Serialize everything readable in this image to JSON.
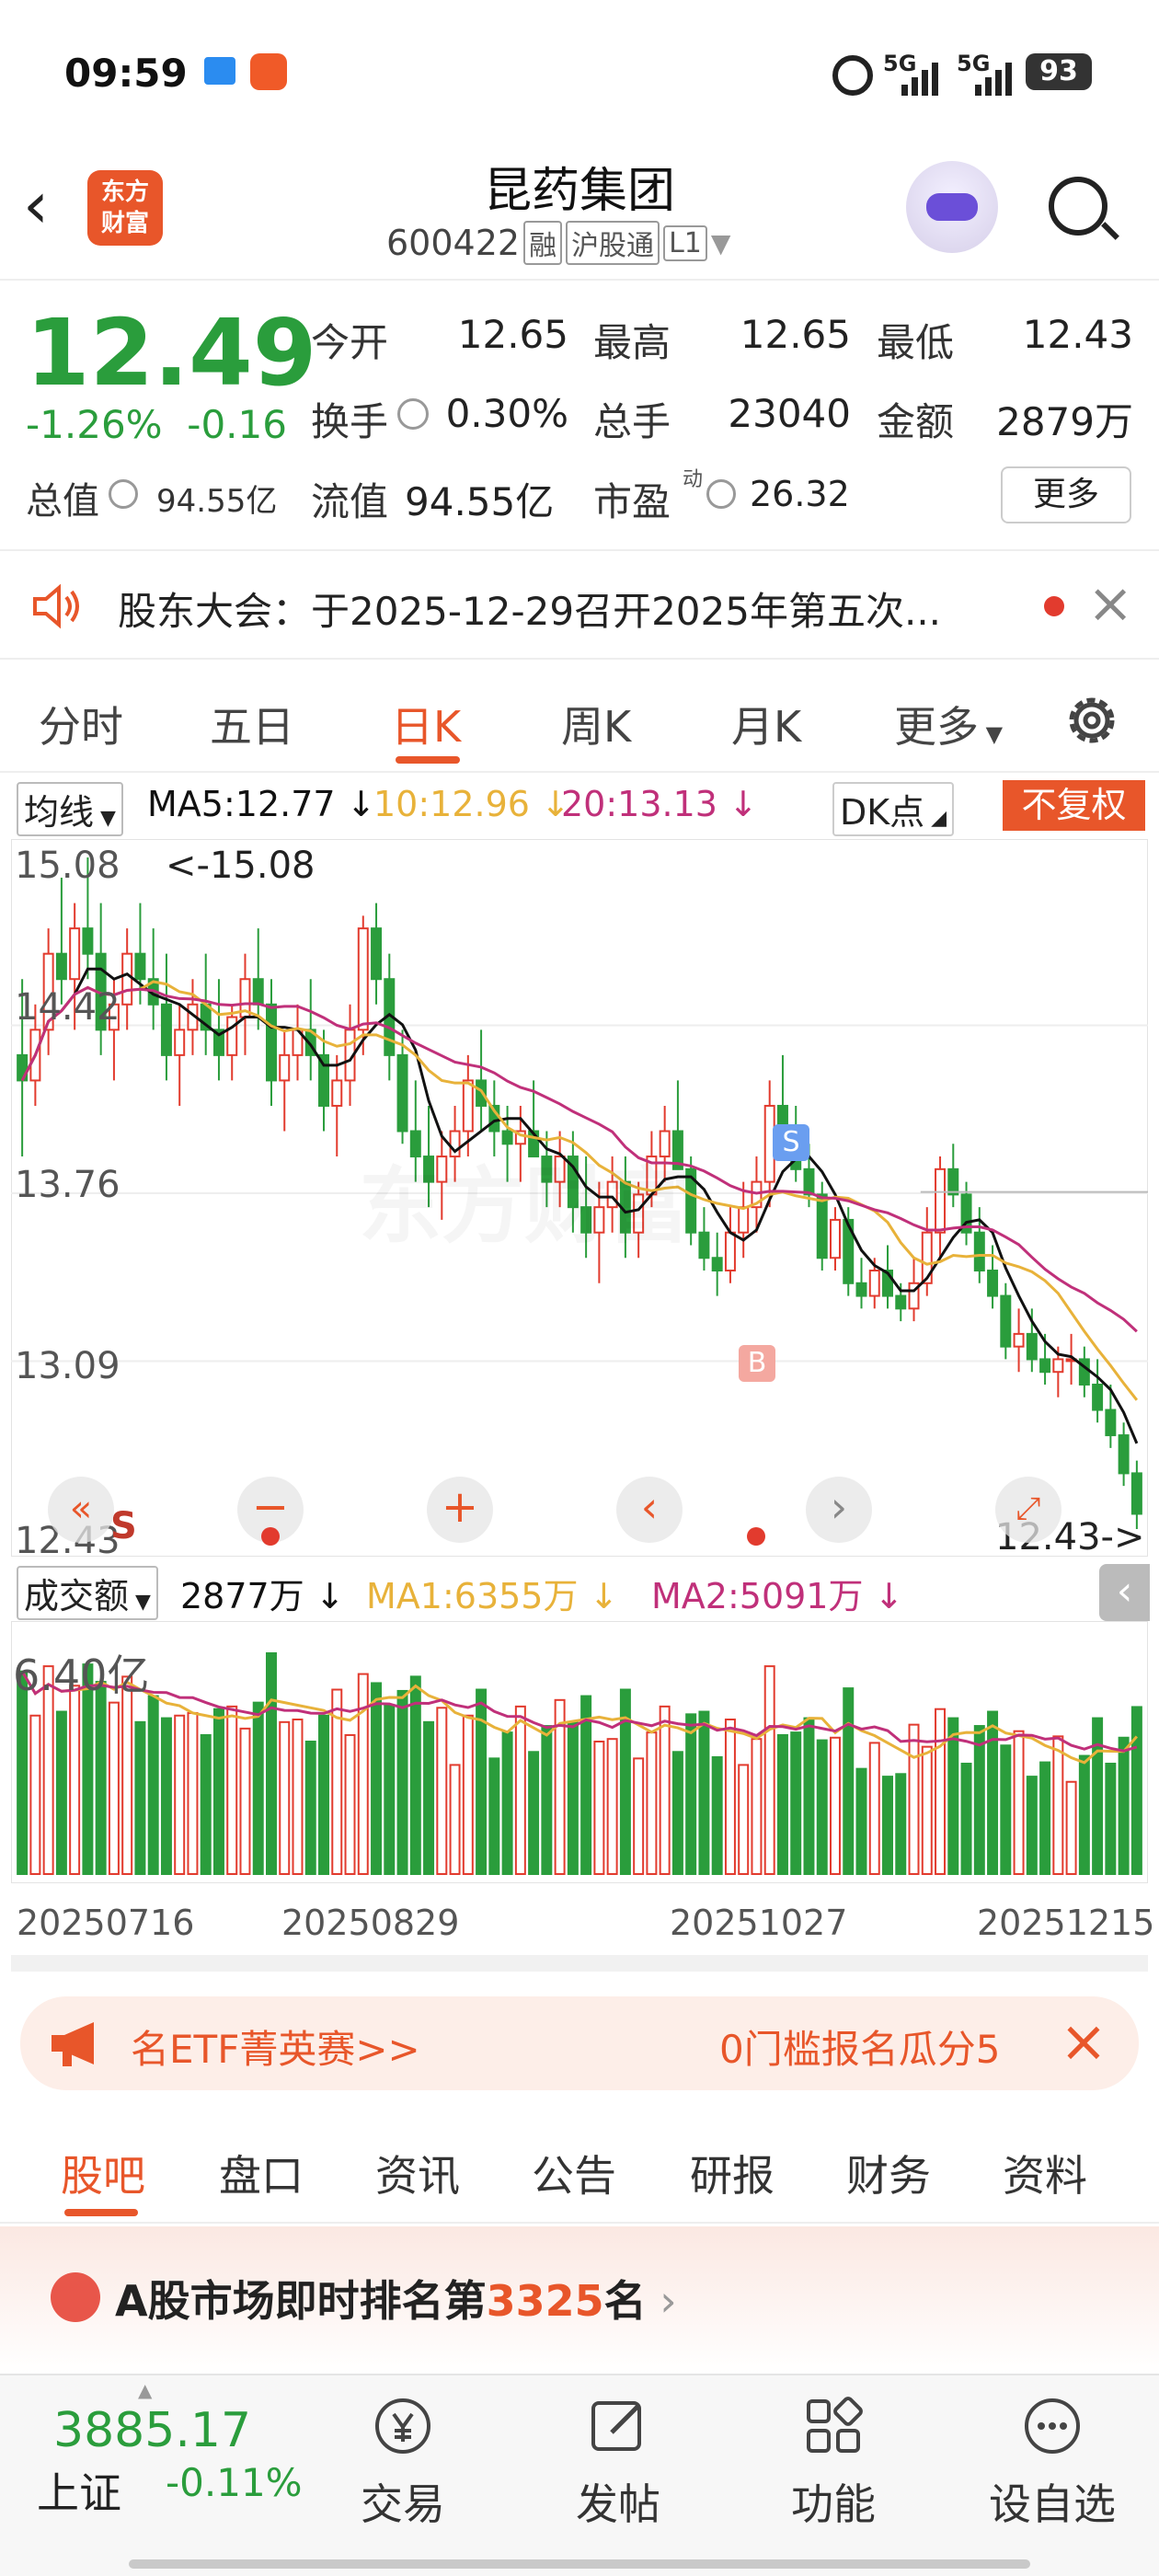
{
  "status_bar": {
    "time": "09:59",
    "net1": "5G",
    "net2": "5G",
    "battery": "93"
  },
  "header": {
    "back_icon": "chevron-left-icon",
    "logo_line1": "东方",
    "logo_line2": "财富",
    "title": "昆药集团",
    "code": "600422",
    "tags": [
      "融",
      "沪股通",
      "L1"
    ]
  },
  "quote": {
    "price": "12.49",
    "change_pct": "-1.26%",
    "change_amt": "-0.16",
    "rows": [
      [
        {
          "label": "今开",
          "value": "12.65"
        },
        {
          "label": "最高",
          "value": "12.65"
        },
        {
          "label": "最低",
          "value": "12.43"
        }
      ],
      [
        {
          "label": "换手",
          "value": "0.30%"
        },
        {
          "label": "总手",
          "value": "23040"
        },
        {
          "label": "金额",
          "value": "2879万"
        }
      ]
    ],
    "total_value_label": "总值",
    "total_value": "94.55亿",
    "float_value_label": "流值",
    "float_value": "94.55亿",
    "pe_label": "市盈",
    "pe_sup": "动",
    "pe_value": "26.32",
    "more_label": "更多"
  },
  "notice": {
    "text": "股东大会：于2025-12-29召开2025年第五次..."
  },
  "period_tabs": [
    "分时",
    "五日",
    "日K",
    "周K",
    "月K",
    "更多"
  ],
  "period_active": "日K",
  "ma_legend": {
    "selector": "均线",
    "ma5": "MA5:12.77",
    "ma10": "10:12.96",
    "ma20": "20:13.13",
    "dk": "DK点",
    "adjust": "不复权"
  },
  "kchart_labels": {
    "y_ticks": [
      "15.08",
      "14.42",
      "13.76",
      "13.09",
      "12.43"
    ],
    "max_note": "<-15.08",
    "min_note": "12.43->",
    "watermark": "东方财富",
    "buy_marker": "B",
    "sell_marker": "S",
    "left_marker": "S"
  },
  "vol_legend": {
    "selector": "成交额",
    "value": "2877万",
    "ma1": "MA1:6355万",
    "ma2": "MA2:5091万"
  },
  "vol_labels": {
    "y_top": "6.40亿"
  },
  "x_dates": [
    "20250716",
    "20250829",
    "20251027",
    "20251215"
  ],
  "banner": {
    "left": "名ETF菁英赛>>",
    "right": "0门槛报名瓜分5"
  },
  "bottom_tabs": [
    "股吧",
    "盘口",
    "资讯",
    "公告",
    "研报",
    "财务",
    "资料"
  ],
  "bottom_active": "股吧",
  "rank": {
    "prefix": "A股市场即时排名第",
    "number": "3325",
    "suffix": "名"
  },
  "bottom_nav": {
    "index_value": "3885.17",
    "index_name": "上证",
    "index_pct": "-0.11%",
    "items": [
      "交易",
      "发帖",
      "功能",
      "设自选"
    ]
  },
  "colors": {
    "up": "#e23b2e",
    "down": "#2a9d3c",
    "accent": "#e8562a",
    "ma5": "#111111",
    "ma10": "#e8b23a",
    "ma20": "#c0307a"
  },
  "chart_data": {
    "type": "candlestick",
    "title": "",
    "ylim": [
      12.43,
      15.08
    ],
    "x_labels": [
      "20250716",
      "20250829",
      "20251027",
      "20251215"
    ],
    "ohlc": [
      [
        14.3,
        14.6,
        13.9,
        14.2
      ],
      [
        14.2,
        14.5,
        14.1,
        14.4
      ],
      [
        14.4,
        14.8,
        14.3,
        14.7
      ],
      [
        14.7,
        15.0,
        14.5,
        14.6
      ],
      [
        14.6,
        14.9,
        14.4,
        14.8
      ],
      [
        14.8,
        15.08,
        14.6,
        14.7
      ],
      [
        14.7,
        14.9,
        14.3,
        14.4
      ],
      [
        14.4,
        14.6,
        14.2,
        14.5
      ],
      [
        14.5,
        14.8,
        14.4,
        14.7
      ],
      [
        14.7,
        14.9,
        14.5,
        14.6
      ],
      [
        14.6,
        14.8,
        14.4,
        14.5
      ],
      [
        14.5,
        14.7,
        14.2,
        14.3
      ],
      [
        14.3,
        14.5,
        14.1,
        14.4
      ],
      [
        14.4,
        14.6,
        14.3,
        14.5
      ],
      [
        14.5,
        14.7,
        14.3,
        14.4
      ],
      [
        14.4,
        14.6,
        14.2,
        14.3
      ],
      [
        14.3,
        14.5,
        14.2,
        14.45
      ],
      [
        14.45,
        14.7,
        14.3,
        14.6
      ],
      [
        14.6,
        14.8,
        14.4,
        14.5
      ],
      [
        14.5,
        14.6,
        14.1,
        14.2
      ],
      [
        14.2,
        14.4,
        14.0,
        14.3
      ],
      [
        14.3,
        14.5,
        14.2,
        14.4
      ],
      [
        14.4,
        14.6,
        14.2,
        14.3
      ],
      [
        14.3,
        14.4,
        14.0,
        14.1
      ],
      [
        14.1,
        14.3,
        13.9,
        14.2
      ],
      [
        14.2,
        14.5,
        14.1,
        14.4
      ],
      [
        14.4,
        14.85,
        14.3,
        14.8
      ],
      [
        14.8,
        14.9,
        14.5,
        14.6
      ],
      [
        14.6,
        14.7,
        14.2,
        14.3
      ],
      [
        14.3,
        14.4,
        13.95,
        14.0
      ],
      [
        14.0,
        14.2,
        13.8,
        13.9
      ],
      [
        13.9,
        14.1,
        13.7,
        13.8
      ],
      [
        13.8,
        14.0,
        13.65,
        13.9
      ],
      [
        13.9,
        14.1,
        13.8,
        14.0
      ],
      [
        14.0,
        14.3,
        13.9,
        14.2
      ],
      [
        14.2,
        14.4,
        14.0,
        14.1
      ],
      [
        14.1,
        14.2,
        13.9,
        14.0
      ],
      [
        14.0,
        14.1,
        13.8,
        13.95
      ],
      [
        13.95,
        14.1,
        13.8,
        14.0
      ],
      [
        14.0,
        14.2,
        13.9,
        13.9
      ],
      [
        13.9,
        14.0,
        13.7,
        13.8
      ],
      [
        13.8,
        14.0,
        13.7,
        13.9
      ],
      [
        13.9,
        14.0,
        13.6,
        13.7
      ],
      [
        13.7,
        13.9,
        13.5,
        13.6
      ],
      [
        13.6,
        13.8,
        13.4,
        13.7
      ],
      [
        13.7,
        13.9,
        13.6,
        13.8
      ],
      [
        13.8,
        13.9,
        13.5,
        13.6
      ],
      [
        13.6,
        13.8,
        13.5,
        13.75
      ],
      [
        13.75,
        14.0,
        13.7,
        13.9
      ],
      [
        13.9,
        14.1,
        13.8,
        14.0
      ],
      [
        14.0,
        14.2,
        13.9,
        13.85
      ],
      [
        13.85,
        13.9,
        13.55,
        13.6
      ],
      [
        13.6,
        13.7,
        13.45,
        13.5
      ],
      [
        13.5,
        13.6,
        13.35,
        13.45
      ],
      [
        13.45,
        13.7,
        13.4,
        13.6
      ],
      [
        13.6,
        13.8,
        13.5,
        13.7
      ],
      [
        13.7,
        13.9,
        13.6,
        13.8
      ],
      [
        13.8,
        14.2,
        13.7,
        14.1
      ],
      [
        14.1,
        14.3,
        13.9,
        14.0
      ],
      [
        14.0,
        14.1,
        13.8,
        13.85
      ],
      [
        13.85,
        13.95,
        13.7,
        13.75
      ],
      [
        13.75,
        13.8,
        13.45,
        13.5
      ],
      [
        13.5,
        13.7,
        13.45,
        13.65
      ],
      [
        13.65,
        13.7,
        13.35,
        13.4
      ],
      [
        13.4,
        13.5,
        13.3,
        13.35
      ],
      [
        13.35,
        13.5,
        13.3,
        13.45
      ],
      [
        13.45,
        13.55,
        13.3,
        13.35
      ],
      [
        13.35,
        13.4,
        13.25,
        13.3
      ],
      [
        13.3,
        13.5,
        13.25,
        13.4
      ],
      [
        13.4,
        13.7,
        13.35,
        13.6
      ],
      [
        13.6,
        13.9,
        13.5,
        13.85
      ],
      [
        13.85,
        13.95,
        13.7,
        13.75
      ],
      [
        13.75,
        13.8,
        13.55,
        13.6
      ],
      [
        13.6,
        13.7,
        13.4,
        13.45
      ],
      [
        13.45,
        13.55,
        13.3,
        13.35
      ],
      [
        13.35,
        13.4,
        13.1,
        13.15
      ],
      [
        13.15,
        13.3,
        13.05,
        13.2
      ],
      [
        13.2,
        13.3,
        13.05,
        13.1
      ],
      [
        13.1,
        13.2,
        13.0,
        13.05
      ],
      [
        13.05,
        13.15,
        12.95,
        13.1
      ],
      [
        13.1,
        13.2,
        13.0,
        13.1
      ],
      [
        13.1,
        13.15,
        12.95,
        13.0
      ],
      [
        13.0,
        13.1,
        12.85,
        12.9
      ],
      [
        12.9,
        13.0,
        12.75,
        12.8
      ],
      [
        12.8,
        12.85,
        12.6,
        12.65
      ],
      [
        12.65,
        12.7,
        12.43,
        12.49
      ]
    ],
    "ma5_last": 12.77,
    "ma10_last": 12.96,
    "ma20_last": 13.13
  }
}
